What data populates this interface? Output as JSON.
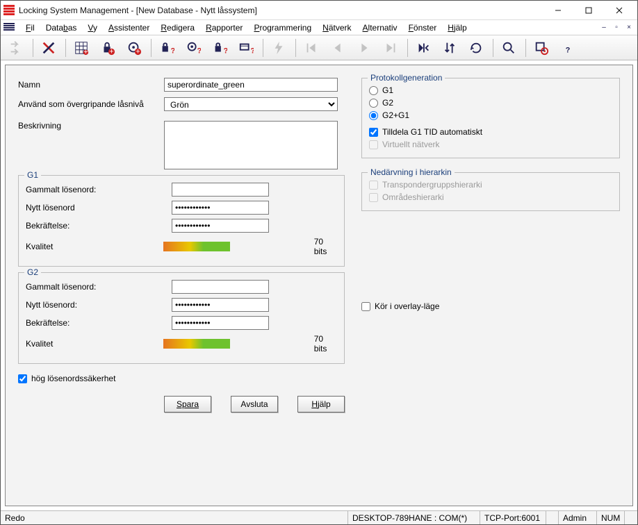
{
  "window": {
    "title": "Locking System Management - [New Database - Nytt låssystem]"
  },
  "menu": {
    "items": [
      "Fil",
      "Databas",
      "Vy",
      "Assistenter",
      "Redigera",
      "Rapporter",
      "Programmering",
      "Nätverk",
      "Alternativ",
      "Fönster",
      "Hjälp"
    ],
    "hotkeys": [
      "F",
      "b",
      "V",
      "A",
      "R",
      "R",
      "P",
      "N",
      "A",
      "F",
      "H"
    ]
  },
  "toolbar": {
    "names": [
      "login",
      "crossed",
      "matrix",
      "lock-add",
      "target-add",
      "lock-q",
      "target-q",
      "lock-q2",
      "card-q",
      "bolt",
      "nav-first",
      "nav-prev",
      "nav-next",
      "nav-last",
      "skip-end",
      "sort",
      "refresh",
      "search",
      "gear-red",
      "help"
    ]
  },
  "form": {
    "name_label": "Namn",
    "name_value": "superordinate_green",
    "level_label": "Använd som övergripande låsnivå",
    "level_value": "Grön",
    "desc_label": "Beskrivning",
    "desc_value": ""
  },
  "g1": {
    "legend": "G1",
    "old_pw": "Gammalt lösenord:",
    "new_pw": "Nytt lösenord",
    "confirm": "Bekräftelse:",
    "quality": "Kvalitet",
    "bits": "70 bits"
  },
  "g2": {
    "legend": "G2",
    "old_pw": "Gammalt lösenord:",
    "new_pw": "Nytt lösenord:",
    "confirm": "Bekräftelse:",
    "quality": "Kvalitet",
    "bits": "70 bits"
  },
  "high_sec": "hög lösenordssäkerhet",
  "protocol": {
    "legend": "Protokollgeneration",
    "g1": "G1",
    "g2": "G2",
    "g2g1": "G2+G1",
    "auto_tid": "Tilldela G1 TID automatiskt",
    "virtual": "Virtuellt nätverk"
  },
  "inherit": {
    "legend": "Nedärvning i hierarkin",
    "transp": "Transpondergruppshierarki",
    "area": "Områdeshierarki"
  },
  "overlay": "Kör i overlay-läge",
  "buttons": {
    "save": "Spara",
    "exit": "Avsluta",
    "help": "Hjälp"
  },
  "status": {
    "ready": "Redo",
    "host": "DESKTOP-789HANE : COM(*)",
    "port": "TCP-Port:6001",
    "user": "Admin",
    "num": "NUM"
  }
}
